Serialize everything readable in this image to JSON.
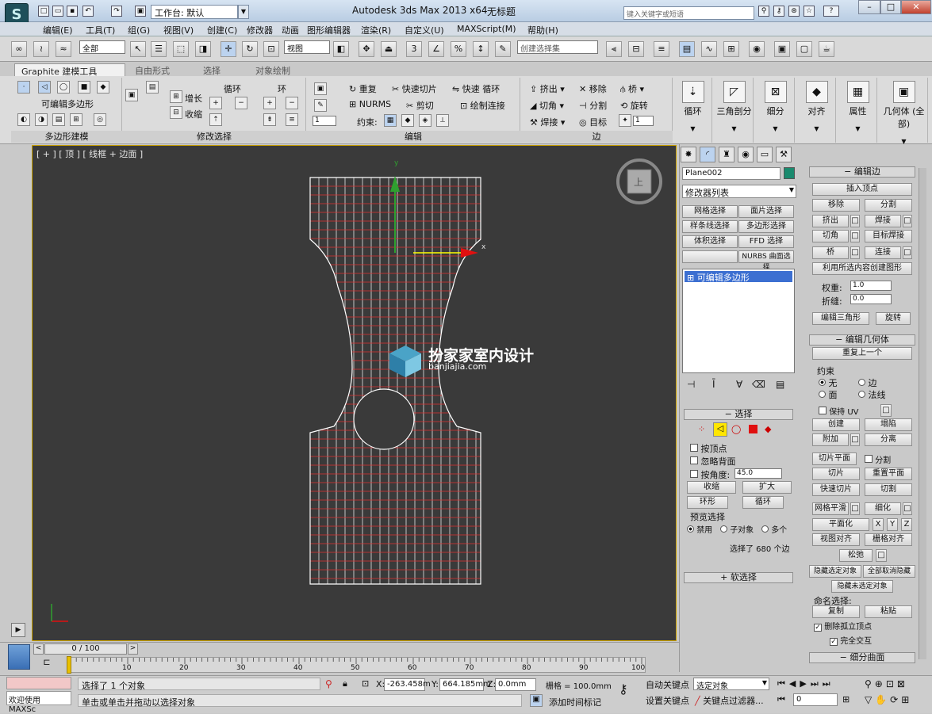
{
  "app": {
    "title": "Autodesk 3ds Max  2013 x64",
    "doc_title": "无标题",
    "logo_text": "S",
    "workspace_label": "工作台: 默认",
    "search_placeholder": "键入关键字或短语"
  },
  "menu": [
    "编辑(E)",
    "工具(T)",
    "组(G)",
    "视图(V)",
    "创建(C)",
    "修改器",
    "动画",
    "图形编辑器",
    "渲染(R)",
    "自定义(U)",
    "MAXScript(M)",
    "帮助(H)"
  ],
  "toolbar": {
    "filter": "全部",
    "coord": "视图",
    "selset": "创建选择集",
    "snap_labels": [
      "3",
      "∠",
      "%",
      "↕"
    ]
  },
  "ribbon": {
    "tabs": [
      "Graphite 建模工具",
      "自由形式",
      "选择",
      "对象绘制"
    ],
    "groups": {
      "polymod": {
        "title": "可编辑多边形",
        "label": "多边形建模"
      },
      "modsel": {
        "label": "修改选择",
        "grow": "增长",
        "shrink": "收缩",
        "loop": "循环",
        "ring": "环"
      },
      "edit": {
        "label": "编辑",
        "repeat": "重复",
        "quickslice": "快速切片",
        "quickloop": "快速 循环",
        "nurms": "NURMS",
        "cut": "剪切",
        "paintconnect": "绘制连接",
        "constraint": "约束:",
        "spin_val": "1"
      },
      "edges": {
        "label": "边",
        "extrude": "挤出",
        "remove": "移除",
        "bridge": "桥",
        "chamfer": "切角",
        "split": "分割",
        "spin": "旋转",
        "weld": "焊接",
        "target": "目标",
        "spin_val": "1"
      }
    },
    "big_buttons": [
      "循环",
      "三角剖分",
      "细分",
      "对齐",
      "属性",
      "几何体 (全部)"
    ]
  },
  "viewport": {
    "label": "[ + ] [ 顶 ] [ 线框 + 边面 ]",
    "watermark_cn": "扮家家室内设计",
    "watermark_en": "banjiajia.com",
    "axis_x": "x",
    "axis_y": "y",
    "viewcube": "上"
  },
  "panel": {
    "object_name": "Plane002",
    "object_color": "#1a8a6e",
    "modifier_list": "修改器列表",
    "mod_buttons": [
      "网格选择",
      "面片选择",
      "样条线选择",
      "多边形选择",
      "体积选择",
      "FFD 选择",
      "",
      "NURBS 曲面选择"
    ],
    "stack_item": "可编辑多边形",
    "selection": {
      "title": "选择",
      "by_vertex": "按顶点",
      "ignore_back": "忽略背面",
      "by_angle": "按角度:",
      "angle_val": "45.0",
      "shrink": "收缩",
      "grow": "扩大",
      "ring": "环形",
      "loop": "循环",
      "preview": "预览选择",
      "disable": "禁用",
      "subobj": "子对象",
      "multi": "多个",
      "status": "选择了 680 个边"
    },
    "soft": "软选择",
    "edit_edges": {
      "title": "编辑边",
      "insert_vertex": "插入顶点",
      "remove": "移除",
      "split": "分割",
      "extrude": "挤出",
      "weld": "焊接",
      "chamfer": "切角",
      "target_weld": "目标焊接",
      "bridge": "桥",
      "connect": "连接",
      "create_shape": "利用所选内容创建图形",
      "weight": "权重:",
      "weight_val": "1.0",
      "crease": "折缝:",
      "crease_val": "0.0",
      "edit_tri": "编辑三角形",
      "turn": "旋转"
    },
    "edit_geom": {
      "title": "编辑几何体",
      "repeat_last": "重复上一个",
      "constraints": "约束",
      "c_none": "无",
      "c_edge": "边",
      "c_face": "面",
      "c_normal": "法线",
      "preserve_uv": "保持 UV",
      "create": "创建",
      "collapse": "塌陷",
      "attach": "附加",
      "detach": "分离",
      "slice_plane": "切片平面",
      "split": "分割",
      "slice": "切片",
      "reset_plane": "重置平面",
      "quickslice": "快速切片",
      "cut": "切割",
      "meshsmooth": "网格平滑",
      "tessellate": "细化",
      "planarize": "平面化",
      "x": "X",
      "y": "Y",
      "z": "Z",
      "view_align": "视图对齐",
      "grid_align": "栅格对齐",
      "relax": "松弛",
      "hide_sel": "隐藏选定对象",
      "unhide_all": "全部取消隐藏",
      "hide_unsel": "隐藏未选定对象",
      "named_sel": "命名选择:",
      "copy": "复制",
      "paste": "粘贴",
      "delete_iso": "删除孤立顶点",
      "full_interact": "完全交互"
    },
    "subdiv": "细分曲面"
  },
  "timeline": {
    "frame": "0 / 100",
    "ticks": [
      "0",
      "10",
      "20",
      "30",
      "40",
      "50",
      "60",
      "70",
      "80",
      "90",
      "100"
    ]
  },
  "status": {
    "maxscript": "欢迎使用 MAXSc",
    "msg1": "选择了 1 个对象",
    "msg2": "单击或单击并拖动以选择对象",
    "x_label": "X:",
    "x_val": "-263.458m",
    "y_label": "Y:",
    "y_val": "664.185mm",
    "z_label": "Z:",
    "z_val": "0.0mm",
    "grid": "栅格 = 100.0mm",
    "autokey": "自动关键点",
    "setkey": "设置关键点",
    "selected_obj": "选定对象",
    "key_filters": "关键点过滤器...",
    "add_time_tag": "添加时间标记",
    "frame_field": "0"
  }
}
